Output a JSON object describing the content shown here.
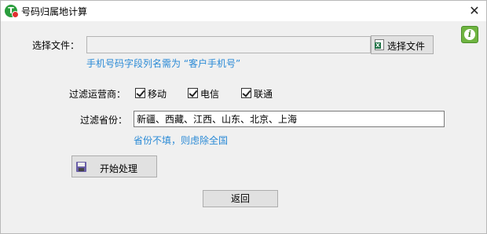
{
  "window": {
    "title": "号码归属地计算",
    "close_glyph": "✕"
  },
  "file": {
    "label": "选择文件：",
    "path_value": "",
    "choose_button_label": "选择文件",
    "hint": "手机号码字段列名需为 “客户手机号”"
  },
  "carrier_filter": {
    "label": "过滤运营商：",
    "options": [
      {
        "label": "移动",
        "checked": true
      },
      {
        "label": "电信",
        "checked": true
      },
      {
        "label": "联通",
        "checked": true
      }
    ]
  },
  "province_filter": {
    "label": "过滤省份：",
    "value": "新疆、西藏、江西、山东、北京、上海",
    "hint": "省份不填，则虑除全国"
  },
  "actions": {
    "start_label": "开始处理",
    "back_label": "返回"
  },
  "info": {
    "glyph": "i"
  },
  "colors": {
    "hint": "#2a8ad6",
    "info_green": "#6fb441",
    "app_icon": "#2a9d3c"
  }
}
